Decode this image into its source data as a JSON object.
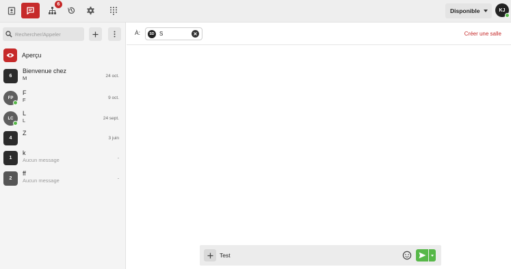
{
  "topbar": {
    "nav": [
      {
        "name": "contacts",
        "icon": "contact-card-icon",
        "active": false
      },
      {
        "name": "messages",
        "icon": "chat-icon",
        "active": true
      },
      {
        "name": "org-chart",
        "icon": "org-chart-icon",
        "active": false,
        "badge": "6"
      },
      {
        "name": "history",
        "icon": "history-icon",
        "active": false
      },
      {
        "name": "settings",
        "icon": "gear-icon",
        "active": false
      },
      {
        "name": "dialpad",
        "icon": "dialpad-icon",
        "active": false
      }
    ],
    "status": "Disponible",
    "user_initials": "KJ"
  },
  "sidebar": {
    "search_placeholder": "Rechercher/Appeler",
    "preview_label": "Aperçu",
    "conversations": [
      {
        "avatar": "6",
        "title": "Bienvenue chez",
        "subtitle": "M",
        "date": "24 oct.",
        "avatar_color": "#2b2b2b",
        "round": false,
        "online": false,
        "muted": false
      },
      {
        "avatar": "FP",
        "title": "F",
        "subtitle": "F",
        "date": "9 oct.",
        "avatar_color": "#5e5e5e",
        "round": true,
        "online": true,
        "muted": false
      },
      {
        "avatar": "LC",
        "title": "L",
        "subtitle": "L",
        "date": "24 sept.",
        "avatar_color": "#5e5e5e",
        "round": true,
        "online": true,
        "muted": false
      },
      {
        "avatar": "4",
        "title": "Z",
        "subtitle": "",
        "date": "3 juin",
        "avatar_color": "#2b2b2b",
        "round": false,
        "online": false,
        "muted": false
      },
      {
        "avatar": "1",
        "title": "k",
        "subtitle": "Aucun message",
        "date": "-",
        "avatar_color": "#2b2b2b",
        "round": false,
        "online": false,
        "muted": true
      },
      {
        "avatar": "2",
        "title": "ff",
        "subtitle": "Aucun message",
        "date": "-",
        "avatar_color": "#555555",
        "round": false,
        "online": false,
        "muted": true
      }
    ]
  },
  "main": {
    "to_label": "À:",
    "recipient": {
      "initials": "SD",
      "name": "S"
    },
    "create_room": "Créer une salle",
    "composer_text": "Test"
  },
  "colors": {
    "accent": "#c62a2a",
    "online": "#57b849",
    "send": "#57b849"
  }
}
